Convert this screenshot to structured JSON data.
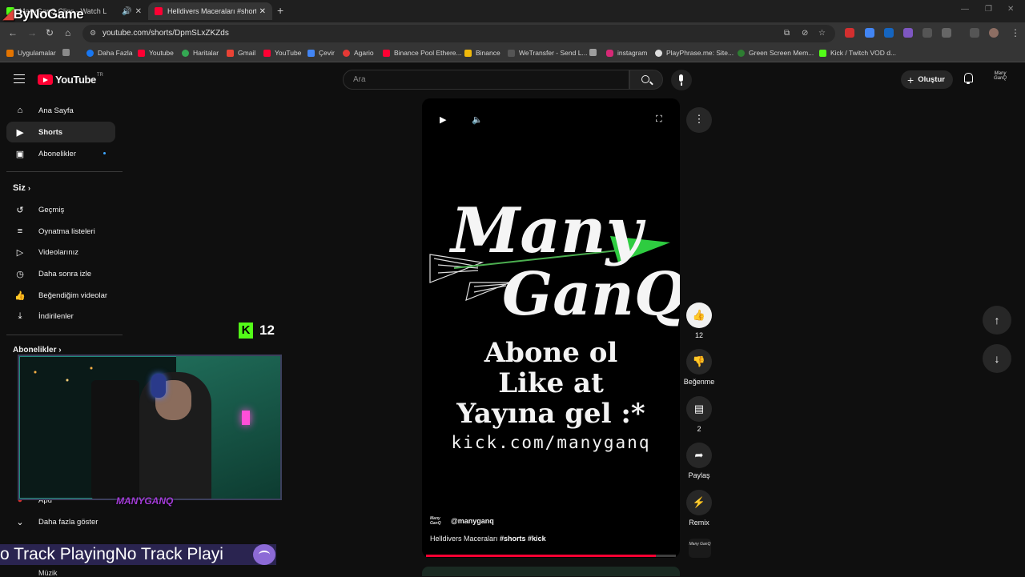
{
  "browser": {
    "watermark": "ByNoGame",
    "tabs": [
      {
        "title": "ManyGanQ Clips - Watch L"
      },
      {
        "title": "Helldivers Maceraları #shorts"
      }
    ],
    "new_tab": "+",
    "url": "youtube.com/shorts/DpmSLxZKZds",
    "bookmarks": [
      {
        "label": "Uygulamalar",
        "color": "#e37400"
      },
      {
        "label": "Daha Fazla",
        "color": "#1877f2"
      },
      {
        "label": "Youtube",
        "color": "#ff0033"
      },
      {
        "label": "Haritalar",
        "color": "#34a853"
      },
      {
        "label": "Gmail",
        "color": "#ea4335"
      },
      {
        "label": "YouTube",
        "color": "#ff0033"
      },
      {
        "label": "Çevir",
        "color": "#4285f4"
      },
      {
        "label": "Agario",
        "color": "#e53935"
      },
      {
        "label": "Binance Pool Ethere...",
        "color": "#ff0033"
      },
      {
        "label": "Binance",
        "color": "#f0b90b"
      },
      {
        "label": "WeTransfer - Send L...",
        "color": "#555555"
      },
      {
        "label": "",
        "color": "#9e9e9e"
      },
      {
        "label": "instagram",
        "color": "#d62976"
      },
      {
        "label": "PlayPhrase.me: Site...",
        "color": "#dddddd"
      },
      {
        "label": "Green Screen Mem...",
        "color": "#2e7d32"
      },
      {
        "label": "Kick / Twitch VOD d...",
        "color": "#53fc18"
      }
    ]
  },
  "youtube": {
    "logo": "YouTube",
    "logo_tm": "TR",
    "search_placeholder": "Ara",
    "create_label": "Oluştur",
    "avatar_text": "Many GanQ",
    "sidebar": {
      "main": [
        {
          "label": "Ana Sayfa",
          "icon": "home-icon"
        },
        {
          "label": "Shorts",
          "icon": "shorts-icon"
        },
        {
          "label": "Abonelikler",
          "icon": "subscriptions-icon"
        }
      ],
      "you_header": "Siz",
      "you": [
        {
          "label": "Geçmiş",
          "icon": "history-icon"
        },
        {
          "label": "Oynatma listeleri",
          "icon": "playlist-icon"
        },
        {
          "label": "Videolarınız",
          "icon": "video-icon"
        },
        {
          "label": "Daha sonra izle",
          "icon": "clock-icon"
        },
        {
          "label": "Beğendiğim videolar",
          "icon": "like-icon"
        },
        {
          "label": "İndirilenler",
          "icon": "download-icon"
        }
      ],
      "subs_header": "Abonelikler",
      "sub_partial": "Apu",
      "more": "Daha fazla göster",
      "music": "Müzik"
    },
    "short": {
      "brand_line1": "Many",
      "brand_line2": "GanQ",
      "promo1": "Abone ol",
      "promo2": "Like at",
      "promo3": "Yayına gel :*",
      "url": "kick.com/manyganq",
      "channel": "@manyganq",
      "caption": "Helldivers Maceraları",
      "hashtags": "#shorts #kick",
      "progress": 0.92
    },
    "actions": {
      "likes": "12",
      "dislike": "Beğenme",
      "comments": "2",
      "share": "Paylaş",
      "remix": "Remix"
    }
  },
  "overlay": {
    "kick_count": "12",
    "ticker": "o Track PlayingNo Track Playi",
    "webcam_name": "MANYGANQ"
  }
}
